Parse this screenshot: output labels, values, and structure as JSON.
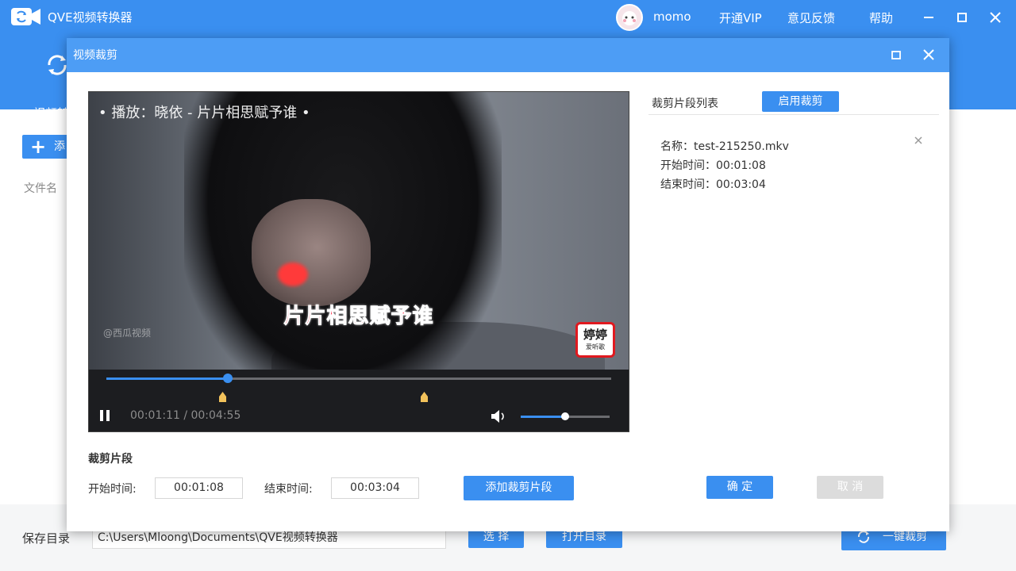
{
  "app": {
    "title": "QVE视频转换器",
    "user_name": "momo",
    "links": {
      "vip": "开通VIP",
      "feedback": "意见反馈",
      "help": "帮助"
    }
  },
  "toolbar": {
    "tool_label": "视频转"
  },
  "main": {
    "add_button_label": "添",
    "file_name_column": "文件名"
  },
  "footer": {
    "save_dir_label": "保存目录",
    "save_dir_value": "C:\\Users\\Mloong\\Documents\\QVE视频转换器",
    "choose_label": "选 择",
    "open_dir_label": "打开目录",
    "one_click_cut_label": "一键裁剪"
  },
  "dialog": {
    "title": "视频裁剪",
    "video": {
      "caption_top": "• 播放：晓依 - 片片相思赋予谁 •",
      "subtitle": "片片相思赋予谁",
      "watermark": "@西瓜视频",
      "badge_main": "婷婷",
      "badge_sub": "爱听歌",
      "time_display": "00:01:11 / 00:04:55",
      "progress_fraction": 0.241,
      "cut_start_fraction": 0.229,
      "cut_end_fraction": 0.629,
      "volume_fraction": 0.5
    },
    "segment": {
      "heading": "裁剪片段",
      "start_label": "开始时间:",
      "start_value": "00:01:08",
      "end_label": "结束时间:",
      "end_value": "00:03:04",
      "add_button": "添加裁剪片段"
    },
    "list": {
      "title": "裁剪片段列表",
      "enable_button": "启用裁剪",
      "items": [
        {
          "name_line": "名称：test-215250.mkv",
          "start_line": "开始时间：00:01:08",
          "end_line": "结束时间：00:03:04"
        }
      ]
    },
    "confirm_label": "确 定",
    "cancel_label": "取 消"
  },
  "colors": {
    "brand_blue": "#3a8ff0",
    "dialog_header": "#4d9df5",
    "disabled_gray": "#dcdcdc"
  }
}
